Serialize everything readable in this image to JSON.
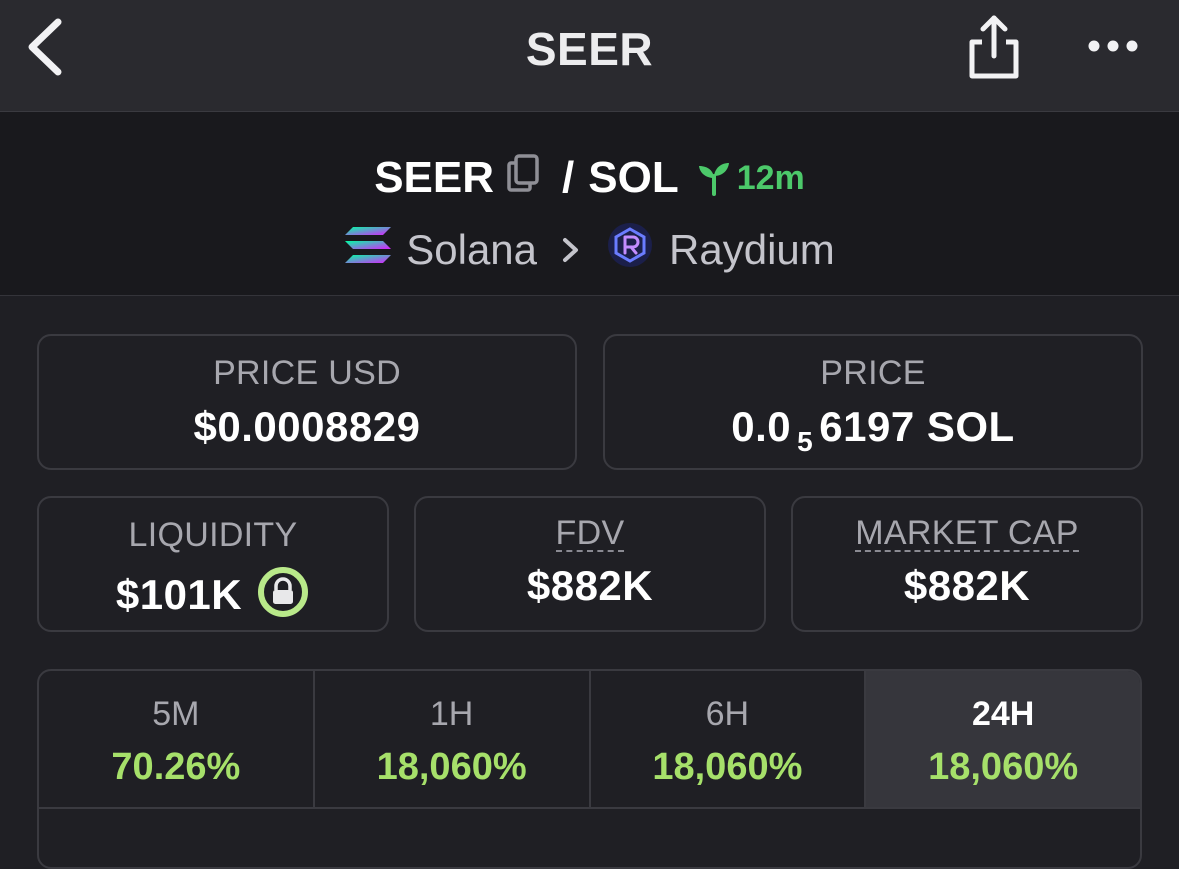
{
  "topbar": {
    "title": "SEER",
    "back_icon": "chevron-left-icon",
    "share_icon": "share-icon",
    "more_icon": "more-horizontal-icon"
  },
  "pair": {
    "base": "SEER",
    "separator": "/",
    "quote": "SOL",
    "age": "12m",
    "age_icon": "sprout-icon",
    "copy_icon": "copy-icon"
  },
  "chain": {
    "name": "Solana",
    "dex": "Raydium",
    "separator_icon": "chevron-right-icon"
  },
  "stats": {
    "price_usd": {
      "label": "PRICE USD",
      "value": "$0.0008829"
    },
    "price": {
      "label": "PRICE",
      "prefix": "0.0",
      "subscript": "5",
      "suffix": "6197 SOL"
    },
    "liquidity": {
      "label": "LIQUIDITY",
      "value": "$101K",
      "icon": "lock-icon"
    },
    "fdv": {
      "label": "FDV",
      "value": "$882K"
    },
    "market_cap": {
      "label": "MARKET CAP",
      "value": "$882K"
    }
  },
  "changes": [
    {
      "label": "5M",
      "value": "70.26%",
      "active": false
    },
    {
      "label": "1H",
      "value": "18,060%",
      "active": false
    },
    {
      "label": "6H",
      "value": "18,060%",
      "active": false
    },
    {
      "label": "24H",
      "value": "18,060%",
      "active": true
    }
  ],
  "colors": {
    "positive": "#a6e06a",
    "age_green": "#4cc96a",
    "lock_ring": "#b9e98a"
  }
}
